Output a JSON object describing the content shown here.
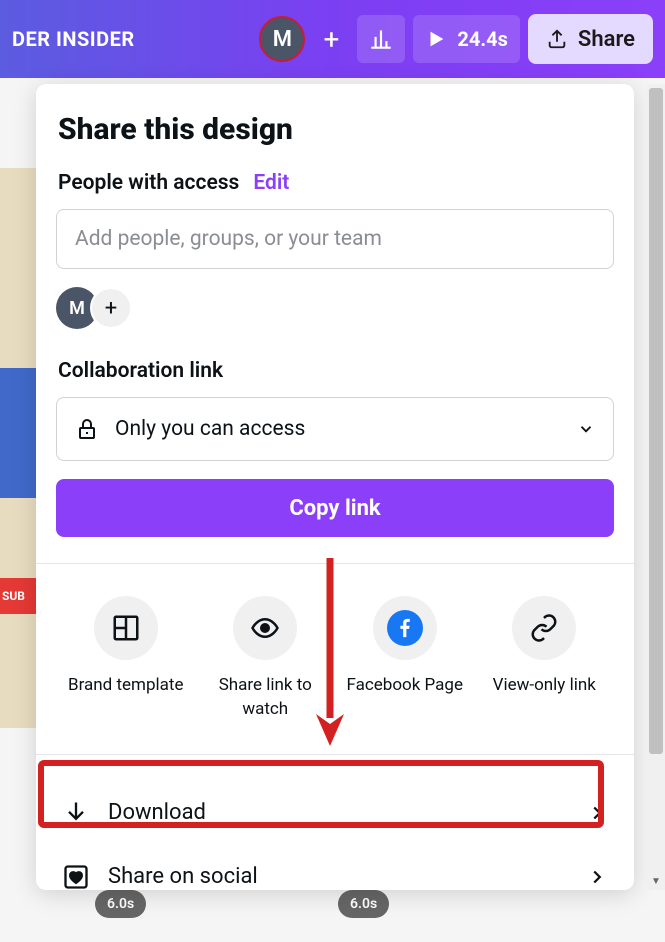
{
  "topbar": {
    "title": "DER INSIDER",
    "avatar_letter": "M",
    "duration": "24.4s",
    "share_label": "Share"
  },
  "panel": {
    "title": "Share this design",
    "access_label": "People with access",
    "edit_label": "Edit",
    "people_placeholder": "Add people, groups, or your team",
    "avatar_letter": "M",
    "collab_label": "Collaboration link",
    "access_select_text": "Only you can access",
    "copy_label": "Copy link"
  },
  "share_options": [
    {
      "label": "Brand template"
    },
    {
      "label": "Share link to watch"
    },
    {
      "label": "Facebook Page"
    },
    {
      "label": "View-only link"
    }
  ],
  "menu_items": {
    "download": "Download",
    "share_social": "Share on social"
  },
  "background": {
    "sub_text": "SUB",
    "clip1": "6.0s",
    "clip2": "6.0s"
  }
}
